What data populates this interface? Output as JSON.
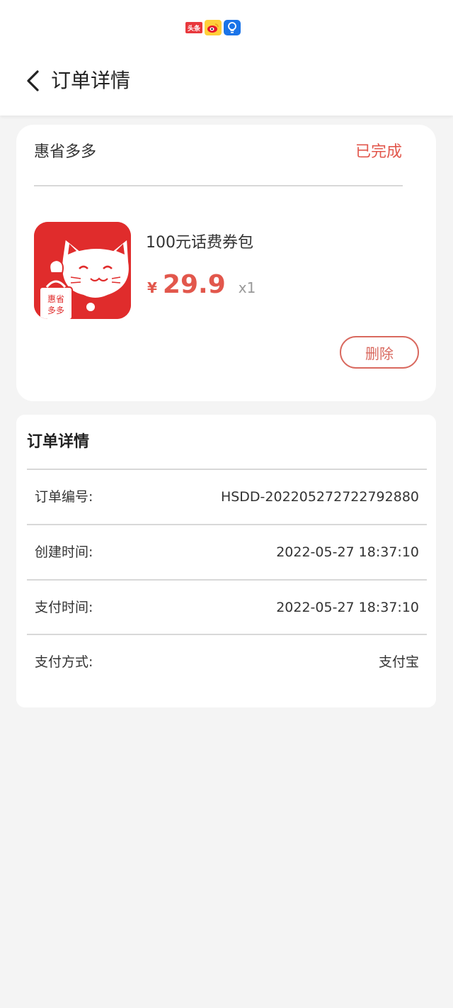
{
  "status_bar": {
    "icons": [
      "toutiao-icon",
      "weibo-icon",
      "lightbulb-icon"
    ],
    "toutiao_label": "头条"
  },
  "header": {
    "title": "订单详情"
  },
  "order": {
    "shop_name": "惠省多多",
    "status": "已完成",
    "product": {
      "name": "100元话费券包",
      "currency_symbol": "¥",
      "price": "29.9",
      "quantity": "x1",
      "logo_text_line1": "惠省",
      "logo_text_line2": "多多"
    },
    "delete_label": "删除"
  },
  "details": {
    "heading": "订单详情",
    "rows": [
      {
        "label": "订单编号:",
        "value": "HSDD-202205272722792880"
      },
      {
        "label": "创建时间:",
        "value": "2022-05-27 18:37:10"
      },
      {
        "label": "支付时间:",
        "value": "2022-05-27 18:37:10"
      },
      {
        "label": "支付方式:",
        "value": "支付宝"
      }
    ]
  },
  "colors": {
    "accent": "#e2574c",
    "background": "#f4f4f4",
    "card": "#ffffff"
  }
}
